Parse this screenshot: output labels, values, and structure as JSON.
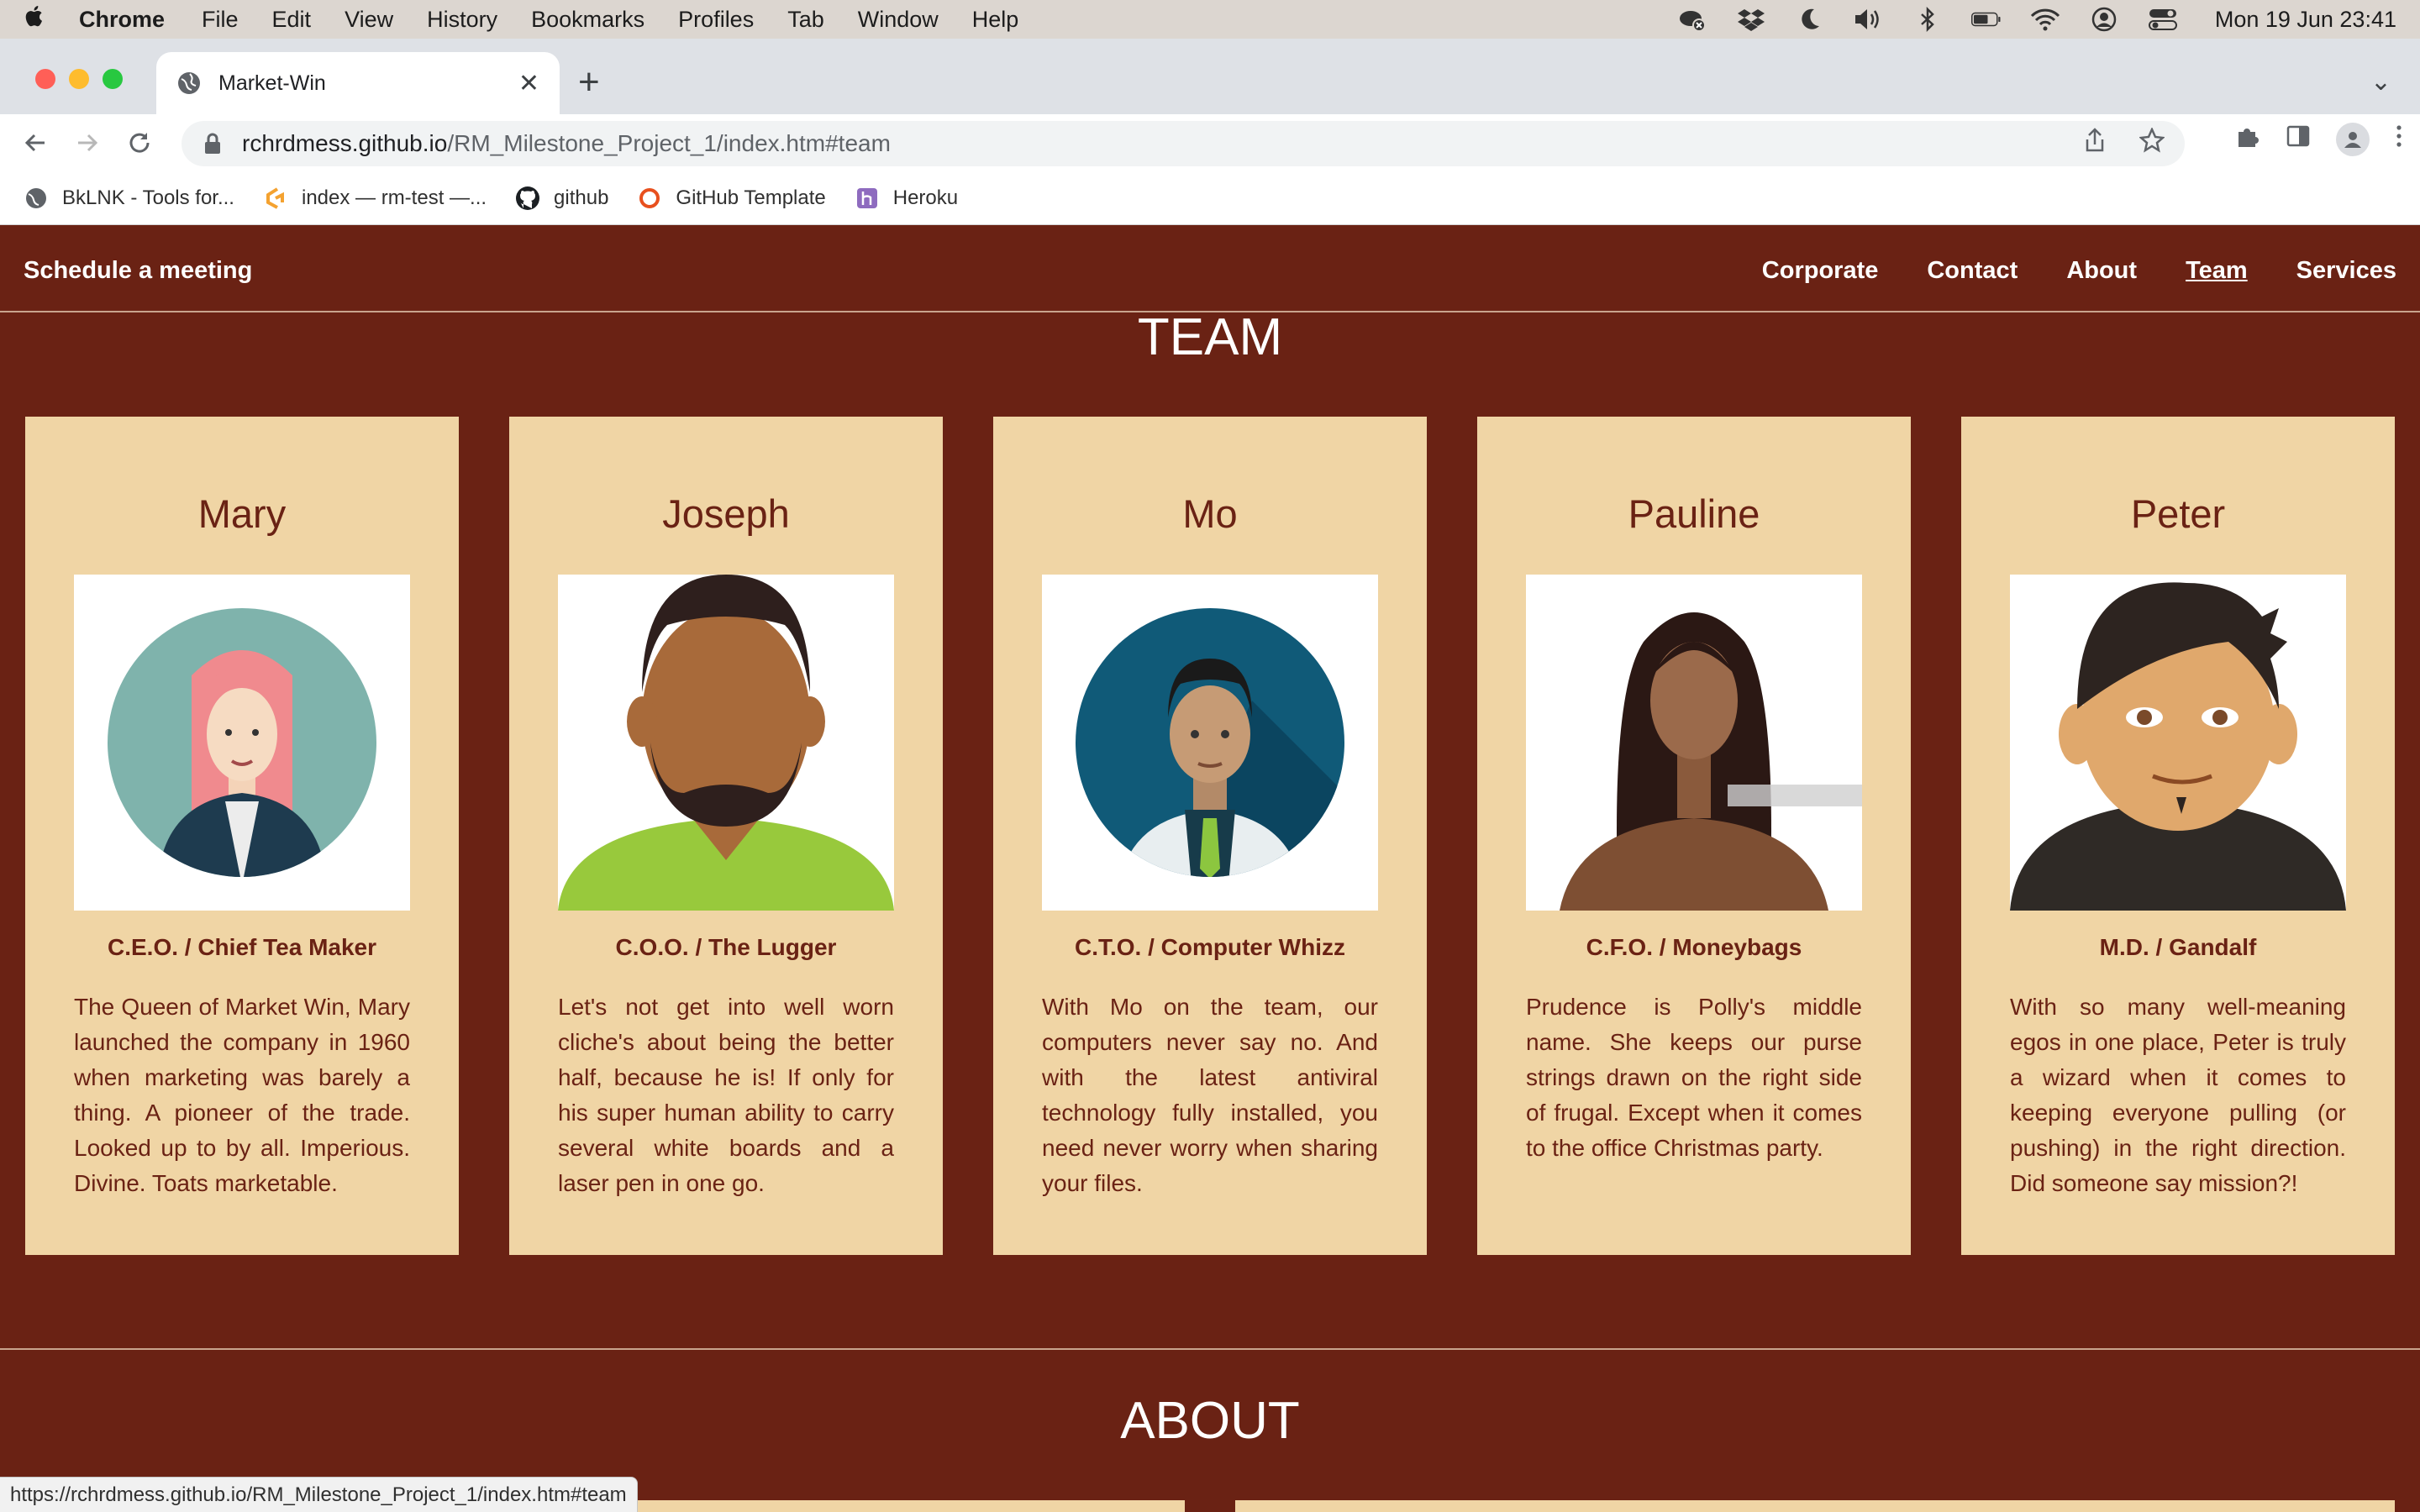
{
  "menubar": {
    "app": "Chrome",
    "items": [
      "File",
      "Edit",
      "View",
      "History",
      "Bookmarks",
      "Profiles",
      "Tab",
      "Window",
      "Help"
    ],
    "clock": "Mon 19 Jun  23:41"
  },
  "browser": {
    "tab_title": "Market-Win",
    "url_host": "rchrdmess.github.io",
    "url_path": "/RM_Milestone_Project_1/index.htm#team",
    "bookmarks": [
      "BkLNK - Tools for...",
      "index — rm-test —...",
      "github",
      "GitHub Template",
      "Heroku"
    ],
    "status_url": "https://rchrdmess.github.io/RM_Milestone_Project_1/index.htm#team"
  },
  "site": {
    "brand": "Schedule a meeting",
    "nav": [
      "Corporate",
      "Contact",
      "About",
      "Team",
      "Services"
    ],
    "active_nav": "Team",
    "team_title": "TEAM",
    "about_title": "ABOUT",
    "colors": {
      "background": "#6a2214",
      "card": "#f0d5a5"
    }
  },
  "team": [
    {
      "name": "Mary",
      "role": "C.E.O. / Chief Tea Maker",
      "bio": "The Queen of Market Win, Mary launched the company in 1960 when marketing was barely a thing. A pioneer of the trade. Looked up to by all. Imperious. Divine. Toats marketable."
    },
    {
      "name": "Joseph",
      "role": "C.O.O. / The Lugger",
      "bio": "Let's not get into well worn cliche's about being the better half, because he is! If only for his super human ability to carry several white boards and a laser pen in one go."
    },
    {
      "name": "Mo",
      "role": "C.T.O. / Computer Whizz",
      "bio": "With Mo on the team, our computers never say no. And with the latest antiviral technology fully installed, you need never worry when sharing your files."
    },
    {
      "name": "Pauline",
      "role": "C.F.O. / Moneybags",
      "bio": "Prudence is Polly's middle name. She keeps our purse strings drawn on the right side of frugal. Except when it comes to the office Christmas party."
    },
    {
      "name": "Peter",
      "role": "M.D. / Gandalf",
      "bio": "With so many well-meaning egos in one place, Peter is truly a wizard when it comes to keeping everyone pulling (or pushing) in the right direction. Did someone say mission?!"
    }
  ]
}
